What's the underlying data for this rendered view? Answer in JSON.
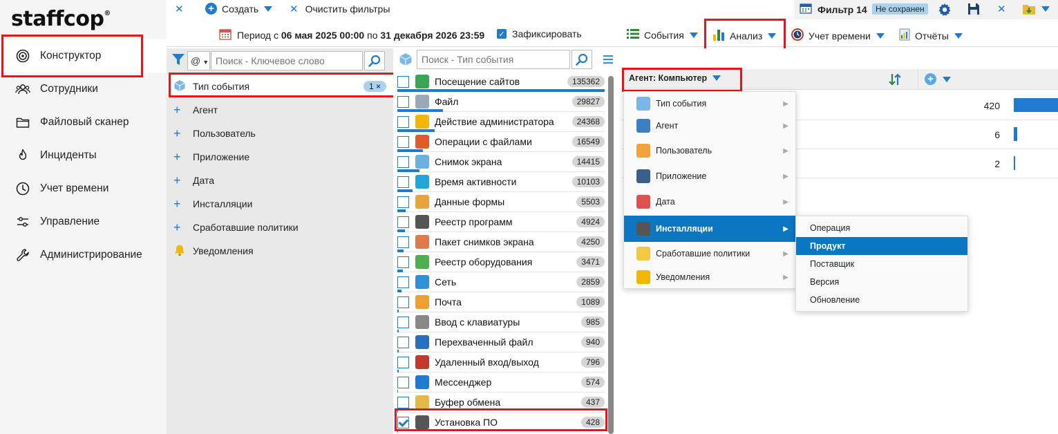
{
  "brand": {
    "logo_text": "staffcop",
    "logo_mark": "®"
  },
  "sidebar": {
    "items": [
      {
        "label": "Конструктор",
        "icon": "target-icon",
        "active": true
      },
      {
        "label": "Сотрудники",
        "icon": "users-icon"
      },
      {
        "label": "Файловый сканер",
        "icon": "folder-icon"
      },
      {
        "label": "Инциденты",
        "icon": "flame-icon"
      },
      {
        "label": "Учет времени",
        "icon": "clock-icon"
      },
      {
        "label": "Управление",
        "icon": "sliders-icon"
      },
      {
        "label": "Администрирование",
        "icon": "wrench-icon"
      }
    ]
  },
  "toolbar_top": {
    "create_label": "Создать",
    "clear_filters_label": "Очистить фильтры",
    "filter_name": "Фильтр 14",
    "unsaved_badge": "Не сохранен"
  },
  "toolbar_second": {
    "period_prefix": "Период с",
    "period_from": "06 мая 2025 00:00",
    "period_mid": "по",
    "period_to": "31 декабря 2026 23:59",
    "fix_label": "Зафиксировать",
    "fix_checked": true,
    "events_label": "События",
    "analysis_label": "Анализ",
    "time_label": "Учет времени",
    "reports_label": "Отчёты"
  },
  "filter_panel": {
    "at_selector": "@",
    "search_placeholder": "Поиск - Ключевое слово",
    "items": [
      {
        "label": "Тип события",
        "badge": "1 ×",
        "selected": true
      },
      {
        "label": "Агент"
      },
      {
        "label": "Пользователь"
      },
      {
        "label": "Приложение"
      },
      {
        "label": "Дата"
      },
      {
        "label": "Инсталляции"
      },
      {
        "label": "Сработавшие политики"
      },
      {
        "label": "Уведомления"
      }
    ]
  },
  "event_panel": {
    "search_placeholder": "Поиск - Тип события",
    "events": [
      {
        "label": "Посещение сайтов",
        "count": "135362",
        "icon_color": "#3aa655"
      },
      {
        "label": "Файл",
        "count": "29827",
        "icon_color": "#9aa9b8"
      },
      {
        "label": "Действие администратора",
        "count": "24368",
        "icon_color": "#f2b705"
      },
      {
        "label": "Операции с файлами",
        "count": "16549",
        "icon_color": "#e05a2b"
      },
      {
        "label": "Снимок экрана",
        "count": "14415",
        "icon_color": "#6cb0e0"
      },
      {
        "label": "Время активности",
        "count": "10103",
        "icon_color": "#1fa7d9"
      },
      {
        "label": "Данные формы",
        "count": "5503",
        "icon_color": "#e8a33b"
      },
      {
        "label": "Реестр программ",
        "count": "4924",
        "icon_color": "#555555"
      },
      {
        "label": "Пакет снимков экрана",
        "count": "4250",
        "icon_color": "#e07a4a"
      },
      {
        "label": "Реестр оборудования",
        "count": "3471",
        "icon_color": "#4caf50"
      },
      {
        "label": "Сеть",
        "count": "2859",
        "icon_color": "#2f8fd8"
      },
      {
        "label": "Почта",
        "count": "1089",
        "icon_color": "#f0a030"
      },
      {
        "label": "Ввод с клавиатуры",
        "count": "985",
        "icon_color": "#888888"
      },
      {
        "label": "Перехваченный файл",
        "count": "940",
        "icon_color": "#2a6fc0"
      },
      {
        "label": "Удаленный вход/выход",
        "count": "796",
        "icon_color": "#c0392b"
      },
      {
        "label": "Мессенджер",
        "count": "574",
        "icon_color": "#1f7bd0"
      },
      {
        "label": "Буфер обмена",
        "count": "437",
        "icon_color": "#e6b84a"
      },
      {
        "label": "Установка ПО",
        "count": "428",
        "icon_color": "#555555",
        "checked": true
      }
    ]
  },
  "right_panel": {
    "group_label": "Агент: Компьютер",
    "rows": [
      {
        "value": "420"
      },
      {
        "value": "6"
      },
      {
        "value": "2"
      }
    ]
  },
  "context_menu": {
    "items": [
      {
        "label": "Тип события",
        "icon_color": "#7bb6e8"
      },
      {
        "label": "Агент",
        "icon_color": "#3d7fc4"
      },
      {
        "label": "Пользователь",
        "icon_color": "#f2a33a"
      },
      {
        "label": "Приложение",
        "icon_color": "#3b5f8a"
      },
      {
        "label": "Дата",
        "icon_color": "#e05050"
      },
      {
        "label": "Инсталляции",
        "icon_color": "#555555",
        "highlighted": true
      },
      {
        "label": "Сработавшие политики",
        "icon_color": "#f5c842"
      },
      {
        "label": "Уведомления",
        "icon_color": "#f2b705"
      }
    ]
  },
  "submenu": {
    "items": [
      {
        "label": "Операция"
      },
      {
        "label": "Продукт",
        "highlighted": true
      },
      {
        "label": "Поставщик"
      },
      {
        "label": "Версия"
      },
      {
        "label": "Обновление"
      }
    ]
  },
  "colors": {
    "accent": "#1f7bd0",
    "highlight": "#0b77c2",
    "annotation": "#e8141b"
  }
}
